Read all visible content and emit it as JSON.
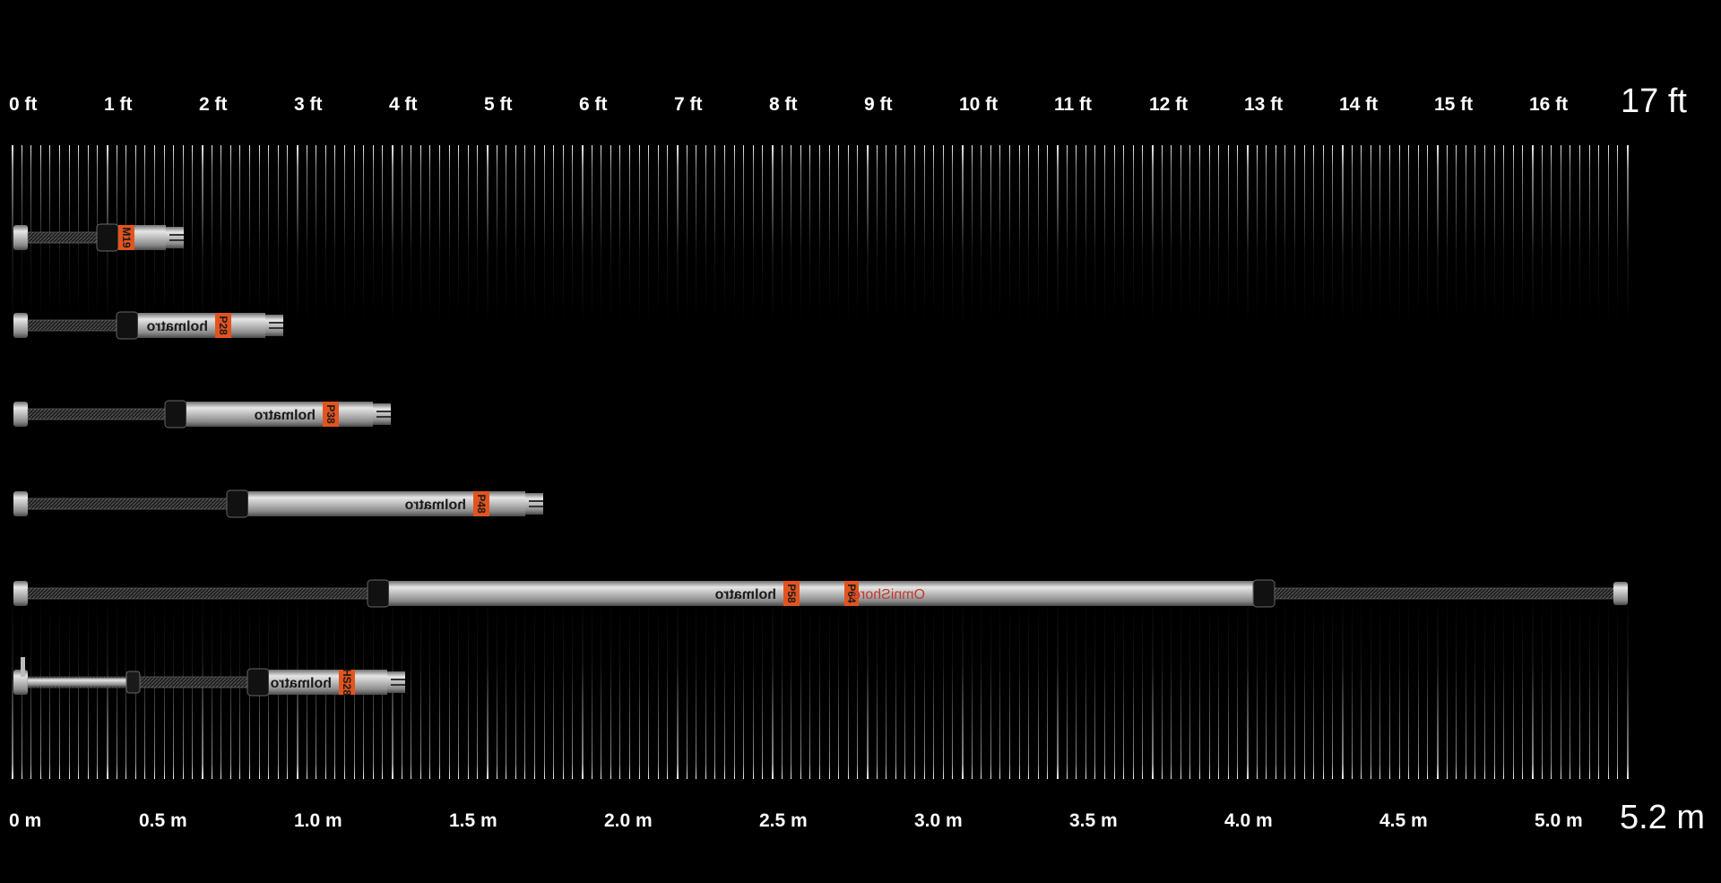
{
  "scale": {
    "feet": {
      "labels": [
        "0 ft",
        "1 ft",
        "2 ft",
        "3 ft",
        "4 ft",
        "5 ft",
        "6 ft",
        "7 ft",
        "8 ft",
        "9 ft",
        "10 ft",
        "11 ft",
        "12 ft",
        "13 ft",
        "14 ft",
        "15 ft",
        "16 ft"
      ],
      "max_label": "17 ft"
    },
    "meters": {
      "labels": [
        "0 m",
        "0.5 m",
        "1.0 m",
        "1.5 m",
        "2.0 m",
        "2.5 m",
        "3.0 m",
        "3.5 m",
        "4.0 m",
        "4.5 m",
        "5.0 m"
      ],
      "max_label": "5.2 m"
    }
  },
  "struts": [
    {
      "brand": "",
      "tag": "M19",
      "color": "#e2541f"
    },
    {
      "brand": "holmatro",
      "tag": "P28",
      "color": "#e2541f"
    },
    {
      "brand": "holmatro",
      "tag": "P38",
      "color": "#e2541f"
    },
    {
      "brand": "holmatro",
      "tag": "P48",
      "color": "#e2541f"
    },
    {
      "brand": "holmatro",
      "tag": "P58",
      "tag2": "P64",
      "product": "OmniShore",
      "color": "#e2541f"
    },
    {
      "brand": "holmatro",
      "tag": "HS28",
      "color": "#e2541f"
    }
  ]
}
